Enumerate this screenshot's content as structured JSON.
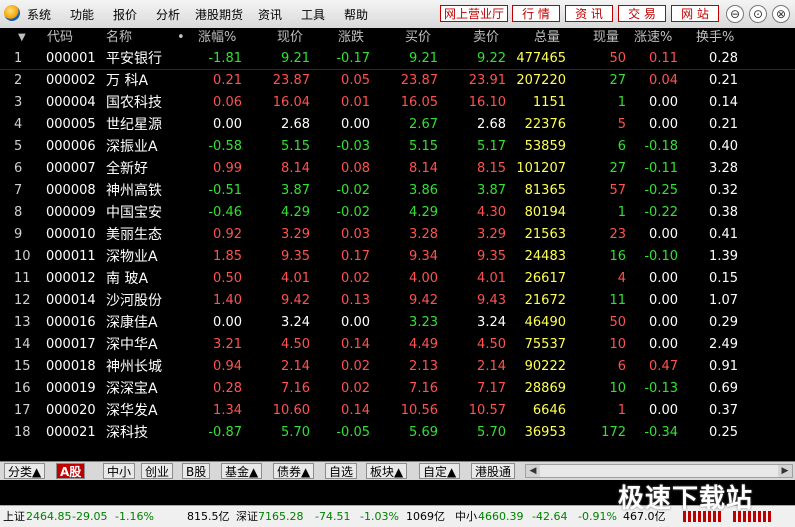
{
  "menu": {
    "items": [
      "系统",
      "功能",
      "报价",
      "分析",
      "港股期货",
      "资讯",
      "工具",
      "帮助"
    ],
    "quick_buttons": [
      "网上营业厅",
      "行 情",
      "资 讯",
      "交 易",
      "网 站"
    ],
    "window_controls": [
      "⊖",
      "⊙",
      "⊗"
    ]
  },
  "table": {
    "headers": [
      "代码",
      "名称",
      "•",
      "涨幅%",
      "现价",
      "涨跌",
      "买价",
      "卖价",
      "总量",
      "现量",
      "涨速%",
      "换手%"
    ],
    "sort_indicator": "▼",
    "rows": [
      {
        "n": "1",
        "code": "000001",
        "name": "平安银行",
        "chg_pct": "-1.81",
        "price": "9.21",
        "chg": "-0.17",
        "bid": "9.21",
        "ask": "9.22",
        "vol": "477465",
        "cur": "50",
        "speed": "0.11",
        "turn": "0.28",
        "dir": "down",
        "cur_dir": "up",
        "speed_dir": "up",
        "vol_hl": true
      },
      {
        "n": "2",
        "code": "000002",
        "name": "万 科A",
        "chg_pct": "0.21",
        "price": "23.87",
        "chg": "0.05",
        "bid": "23.87",
        "ask": "23.91",
        "vol": "207220",
        "cur": "27",
        "speed": "0.04",
        "turn": "0.21",
        "dir": "up",
        "cur_dir": "down",
        "speed_dir": "up"
      },
      {
        "n": "3",
        "code": "000004",
        "name": "国农科技",
        "chg_pct": "0.06",
        "price": "16.04",
        "chg": "0.01",
        "bid": "16.05",
        "ask": "16.10",
        "vol": "1151",
        "cur": "1",
        "speed": "0.00",
        "turn": "0.14",
        "dir": "up",
        "cur_dir": "down",
        "speed_dir": "flat"
      },
      {
        "n": "4",
        "code": "000005",
        "name": "世纪星源",
        "chg_pct": "0.00",
        "price": "2.68",
        "chg": "0.00",
        "bid": "2.67",
        "ask": "2.68",
        "vol": "22376",
        "cur": "5",
        "speed": "0.00",
        "turn": "0.21",
        "dir": "flat",
        "bid_dir": "down",
        "cur_dir": "up",
        "speed_dir": "flat"
      },
      {
        "n": "5",
        "code": "000006",
        "name": "深振业A",
        "chg_pct": "-0.58",
        "price": "5.15",
        "chg": "-0.03",
        "bid": "5.15",
        "ask": "5.17",
        "vol": "53859",
        "cur": "6",
        "speed": "-0.18",
        "turn": "0.40",
        "dir": "down",
        "cur_dir": "down",
        "speed_dir": "down"
      },
      {
        "n": "6",
        "code": "000007",
        "name": "全新好",
        "chg_pct": "0.99",
        "price": "8.14",
        "chg": "0.08",
        "bid": "8.14",
        "ask": "8.15",
        "vol": "101207",
        "cur": "27",
        "speed": "-0.11",
        "turn": "3.28",
        "dir": "up",
        "cur_dir": "down",
        "speed_dir": "down"
      },
      {
        "n": "7",
        "code": "000008",
        "name": "神州高铁",
        "chg_pct": "-0.51",
        "price": "3.87",
        "chg": "-0.02",
        "bid": "3.86",
        "ask": "3.87",
        "vol": "81365",
        "cur": "57",
        "speed": "-0.25",
        "turn": "0.32",
        "dir": "down",
        "cur_dir": "up",
        "speed_dir": "down"
      },
      {
        "n": "8",
        "code": "000009",
        "name": "中国宝安",
        "chg_pct": "-0.46",
        "price": "4.29",
        "chg": "-0.02",
        "bid": "4.29",
        "ask": "4.30",
        "vol": "80194",
        "cur": "1",
        "speed": "-0.22",
        "turn": "0.38",
        "dir": "down",
        "ask_dir": "up",
        "cur_dir": "down",
        "speed_dir": "down"
      },
      {
        "n": "9",
        "code": "000010",
        "name": "美丽生态",
        "chg_pct": "0.92",
        "price": "3.29",
        "chg": "0.03",
        "bid": "3.28",
        "ask": "3.29",
        "vol": "21563",
        "cur": "23",
        "speed": "0.00",
        "turn": "0.41",
        "dir": "up",
        "cur_dir": "up",
        "speed_dir": "flat"
      },
      {
        "n": "10",
        "code": "000011",
        "name": "深物业A",
        "chg_pct": "1.85",
        "price": "9.35",
        "chg": "0.17",
        "bid": "9.34",
        "ask": "9.35",
        "vol": "24483",
        "cur": "16",
        "speed": "-0.10",
        "turn": "1.39",
        "dir": "up",
        "cur_dir": "down",
        "speed_dir": "down"
      },
      {
        "n": "11",
        "code": "000012",
        "name": "南 玻A",
        "chg_pct": "0.50",
        "price": "4.01",
        "chg": "0.02",
        "bid": "4.00",
        "ask": "4.01",
        "vol": "26617",
        "cur": "4",
        "speed": "0.00",
        "turn": "0.15",
        "dir": "up",
        "cur_dir": "up",
        "speed_dir": "flat"
      },
      {
        "n": "12",
        "code": "000014",
        "name": "沙河股份",
        "chg_pct": "1.40",
        "price": "9.42",
        "chg": "0.13",
        "bid": "9.42",
        "ask": "9.43",
        "vol": "21672",
        "cur": "11",
        "speed": "0.00",
        "turn": "1.07",
        "dir": "up",
        "cur_dir": "down",
        "speed_dir": "flat"
      },
      {
        "n": "13",
        "code": "000016",
        "name": "深康佳A",
        "chg_pct": "0.00",
        "price": "3.24",
        "chg": "0.00",
        "bid": "3.23",
        "ask": "3.24",
        "vol": "46490",
        "cur": "50",
        "speed": "0.00",
        "turn": "0.29",
        "dir": "flat",
        "bid_dir": "down",
        "cur_dir": "up",
        "speed_dir": "flat"
      },
      {
        "n": "14",
        "code": "000017",
        "name": "深中华A",
        "chg_pct": "3.21",
        "price": "4.50",
        "chg": "0.14",
        "bid": "4.49",
        "ask": "4.50",
        "vol": "75537",
        "cur": "10",
        "speed": "0.00",
        "turn": "2.49",
        "dir": "up",
        "cur_dir": "up",
        "speed_dir": "flat"
      },
      {
        "n": "15",
        "code": "000018",
        "name": "神州长城",
        "chg_pct": "0.94",
        "price": "2.14",
        "chg": "0.02",
        "bid": "2.13",
        "ask": "2.14",
        "vol": "90222",
        "cur": "6",
        "speed": "0.47",
        "turn": "0.91",
        "dir": "up",
        "cur_dir": "up",
        "speed_dir": "up"
      },
      {
        "n": "16",
        "code": "000019",
        "name": "深深宝A",
        "chg_pct": "0.28",
        "price": "7.16",
        "chg": "0.02",
        "bid": "7.16",
        "ask": "7.17",
        "vol": "28869",
        "cur": "10",
        "speed": "-0.13",
        "turn": "0.69",
        "dir": "up",
        "cur_dir": "down",
        "speed_dir": "down"
      },
      {
        "n": "17",
        "code": "000020",
        "name": "深华发A",
        "chg_pct": "1.34",
        "price": "10.60",
        "chg": "0.14",
        "bid": "10.56",
        "ask": "10.57",
        "vol": "6646",
        "cur": "1",
        "speed": "0.00",
        "turn": "0.37",
        "dir": "up",
        "cur_dir": "up",
        "speed_dir": "flat"
      },
      {
        "n": "18",
        "code": "000021",
        "name": "深科技",
        "chg_pct": "-0.87",
        "price": "5.70",
        "chg": "-0.05",
        "bid": "5.69",
        "ask": "5.70",
        "vol": "36953",
        "cur": "172",
        "speed": "-0.34",
        "turn": "0.25",
        "dir": "down",
        "cur_dir": "down",
        "speed_dir": "down"
      }
    ]
  },
  "tabs": [
    "分类▲",
    "A股",
    "中小",
    "创业",
    "B股",
    "基金▲",
    "债券▲",
    "自选",
    "板块▲",
    "自定▲",
    "港股通"
  ],
  "active_tab": "A股",
  "status": {
    "sh_label": "上证",
    "sh_index": "2464.85",
    "sh_chg": "-29.05",
    "sh_pct": "-1.16%",
    "sh_amt": "815.5亿",
    "sz_label": "深证",
    "sz_index": "7165.28",
    "sz_chg": "-74.51",
    "sz_pct": "-1.03%",
    "sz_amt": "1069亿",
    "zx_label": "中小",
    "zx_index": "4660.39",
    "zx_chg": "-42.64",
    "zx_pct": "-0.91%",
    "zx_amt": "467.0亿"
  },
  "watermark": "极速下载站",
  "colors": {
    "up": "#ff5252",
    "down": "#33e033",
    "flat": "#ffffff",
    "code": "#ffffff",
    "name": "#ffffff",
    "volume": "#ffff54",
    "accent": "#c00000"
  }
}
